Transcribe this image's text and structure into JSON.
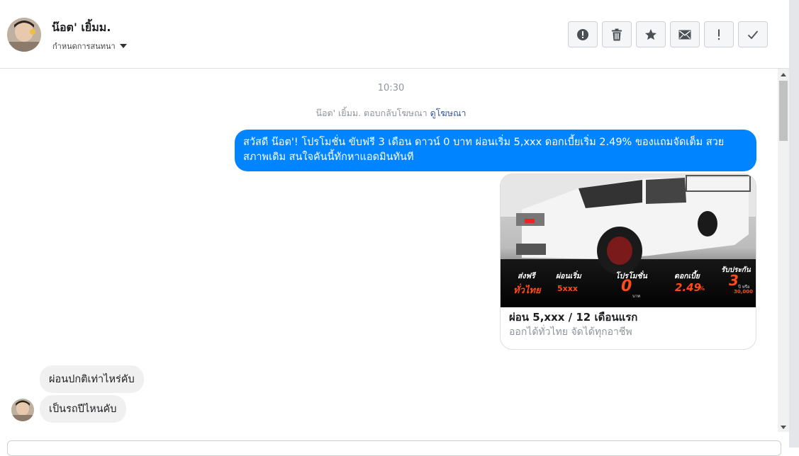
{
  "header": {
    "contact_name": "น๊อต' เยิ้มม.",
    "assign_label": "กำหนดการสนทนา",
    "actions": [
      {
        "name": "mark-spam-button",
        "icon": "alert-circle-icon"
      },
      {
        "name": "delete-button",
        "icon": "trash-icon"
      },
      {
        "name": "star-button",
        "icon": "star-icon"
      },
      {
        "name": "mark-unread-button",
        "icon": "envelope-icon"
      },
      {
        "name": "follow-up-button",
        "icon": "exclamation-icon"
      },
      {
        "name": "mark-done-button",
        "icon": "checkmark-icon"
      }
    ]
  },
  "thread": {
    "timestamp": "10:30",
    "ad_reply_text": "น๊อต' เยิ้มม. ตอบกลับโฆษณา",
    "ad_reply_link": "ดูโฆษณา",
    "outgoing_message": "สวัสดี น๊อต'! โปรโมชั่น ขับฟรี 3 เดือน ดาวน์ 0 บาท ผ่อนเริ่ม 5,xxx  ดอกเบี้ยเริ่ม 2.49% ของแถมจัดเต็ม สวยสภาพเดิม สนใจคันนี้ทักหาแอดมินทันที",
    "ad_card": {
      "title": "ผ่อน 5,xxx / 12 เดือนแรก",
      "subtitle": "ออกได้ทั่วไทย จัดได้ทุกอาชีพ",
      "image_promos": [
        {
          "label": "ส่งฟรี",
          "value": "ทั่วไทย"
        },
        {
          "label": "ผ่อนเริ่ม",
          "value": "5xxx"
        },
        {
          "label": "โปรโมชั่น",
          "value": "0"
        },
        {
          "label": "ดอกเบี้ย",
          "value": "2.49"
        },
        {
          "label": "รับประกัน",
          "value": "3"
        }
      ],
      "image_small": [
        "บาท",
        "%",
        "ปี หรือ",
        "30,000"
      ]
    },
    "incoming_messages": [
      "ผ่อนปกติเท่าไหร่คับ",
      "เป็นรถปีไหนคับ"
    ]
  },
  "colors": {
    "brand_blue": "#0084ff",
    "incoming_bubble": "#f1f0f0",
    "promo_orange": "#ff4a1a"
  }
}
